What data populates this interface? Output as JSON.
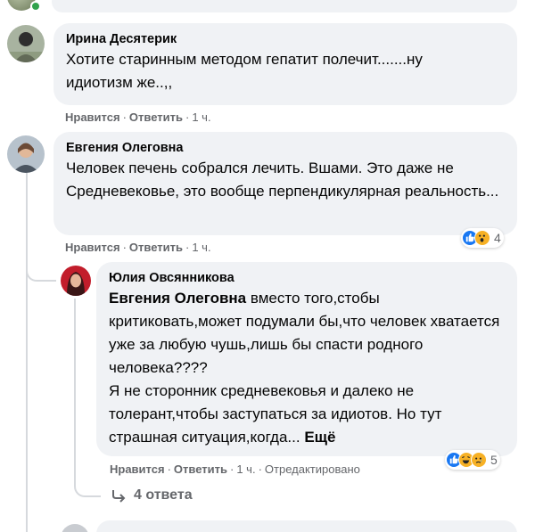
{
  "comments": [
    {
      "author": "Ирина Десятерик",
      "text": "Хотите старинным методом гепатит полечит.......ну идиотизм же..,,",
      "like": "Нравится",
      "reply": "Ответить",
      "time": "1 ч."
    },
    {
      "author": "Евгения Олеговна",
      "text": "Человек печень собрался лечить. Вшами. Это даже не Средневековье, это вообще перпендикулярная реальность...",
      "like": "Нравится",
      "reply": "Ответить",
      "time": "1 ч.",
      "reaction_count": "4"
    }
  ],
  "reply": {
    "author": "Юлия Овсянникова",
    "mention": "Евгения Олеговна",
    "text": " вместо того,стобы критиковать,может подумали бы,что человек хватается уже за любую чушь,лишь бы спасти родного человека????",
    "text2": "Я не сторонник средневековья и далеко не толерант,чтобы заступаться за идиотов. Но тут страшная ситуация,когда...",
    "more": "Ещё",
    "like": "Нравится",
    "reply": "Ответить",
    "time": "1 ч.",
    "edited": "Отредактировано",
    "reaction_count": "5"
  },
  "replies_link": "4 ответа",
  "separator": "·",
  "colors": {
    "bubble": "#f0f2f5",
    "meta": "#65676b",
    "like": "#1877f2",
    "emoji": "#f7b125",
    "online": "#31a24c"
  }
}
